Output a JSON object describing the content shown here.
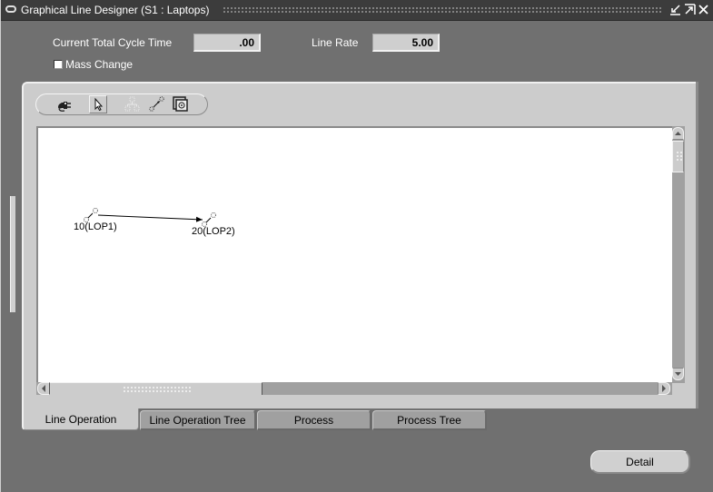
{
  "window": {
    "title": "Graphical Line Designer (S1 : Laptops)",
    "controls": [
      "minimize-icon",
      "maximize-icon",
      "close-icon"
    ]
  },
  "header": {
    "cycle_time_label": "Current Total Cycle Time",
    "cycle_time_value": ".00",
    "line_rate_label": "Line Rate",
    "line_rate_value": "5.00",
    "mass_change_label": "Mass Change",
    "mass_change_checked": false
  },
  "toolbar": {
    "buttons": [
      {
        "icon": "plug-connect-icon",
        "enabled": true
      },
      {
        "icon": "pointer-select-icon",
        "enabled": true,
        "selected": true
      },
      {
        "icon": "network-layout-icon",
        "enabled": false
      },
      {
        "icon": "connect-nodes-icon",
        "enabled": true
      },
      {
        "icon": "properties-icon",
        "enabled": true
      }
    ]
  },
  "diagram": {
    "nodes": [
      {
        "label": "10(LOP1)"
      },
      {
        "label": "20(LOP2)"
      }
    ],
    "edges": [
      {
        "from": "10(LOP1)",
        "to": "20(LOP2)"
      }
    ]
  },
  "tabs": [
    {
      "label": "Line Operation",
      "active": true
    },
    {
      "label": "Line Operation Tree",
      "active": false
    },
    {
      "label": "Process",
      "active": false
    },
    {
      "label": "Process Tree",
      "active": false
    }
  ],
  "footer": {
    "detail_label": "Detail"
  },
  "colors": {
    "background": "#707070",
    "panel": "#cccccc",
    "titlebar": "#3c3c3c",
    "canvas": "#ffffff"
  }
}
